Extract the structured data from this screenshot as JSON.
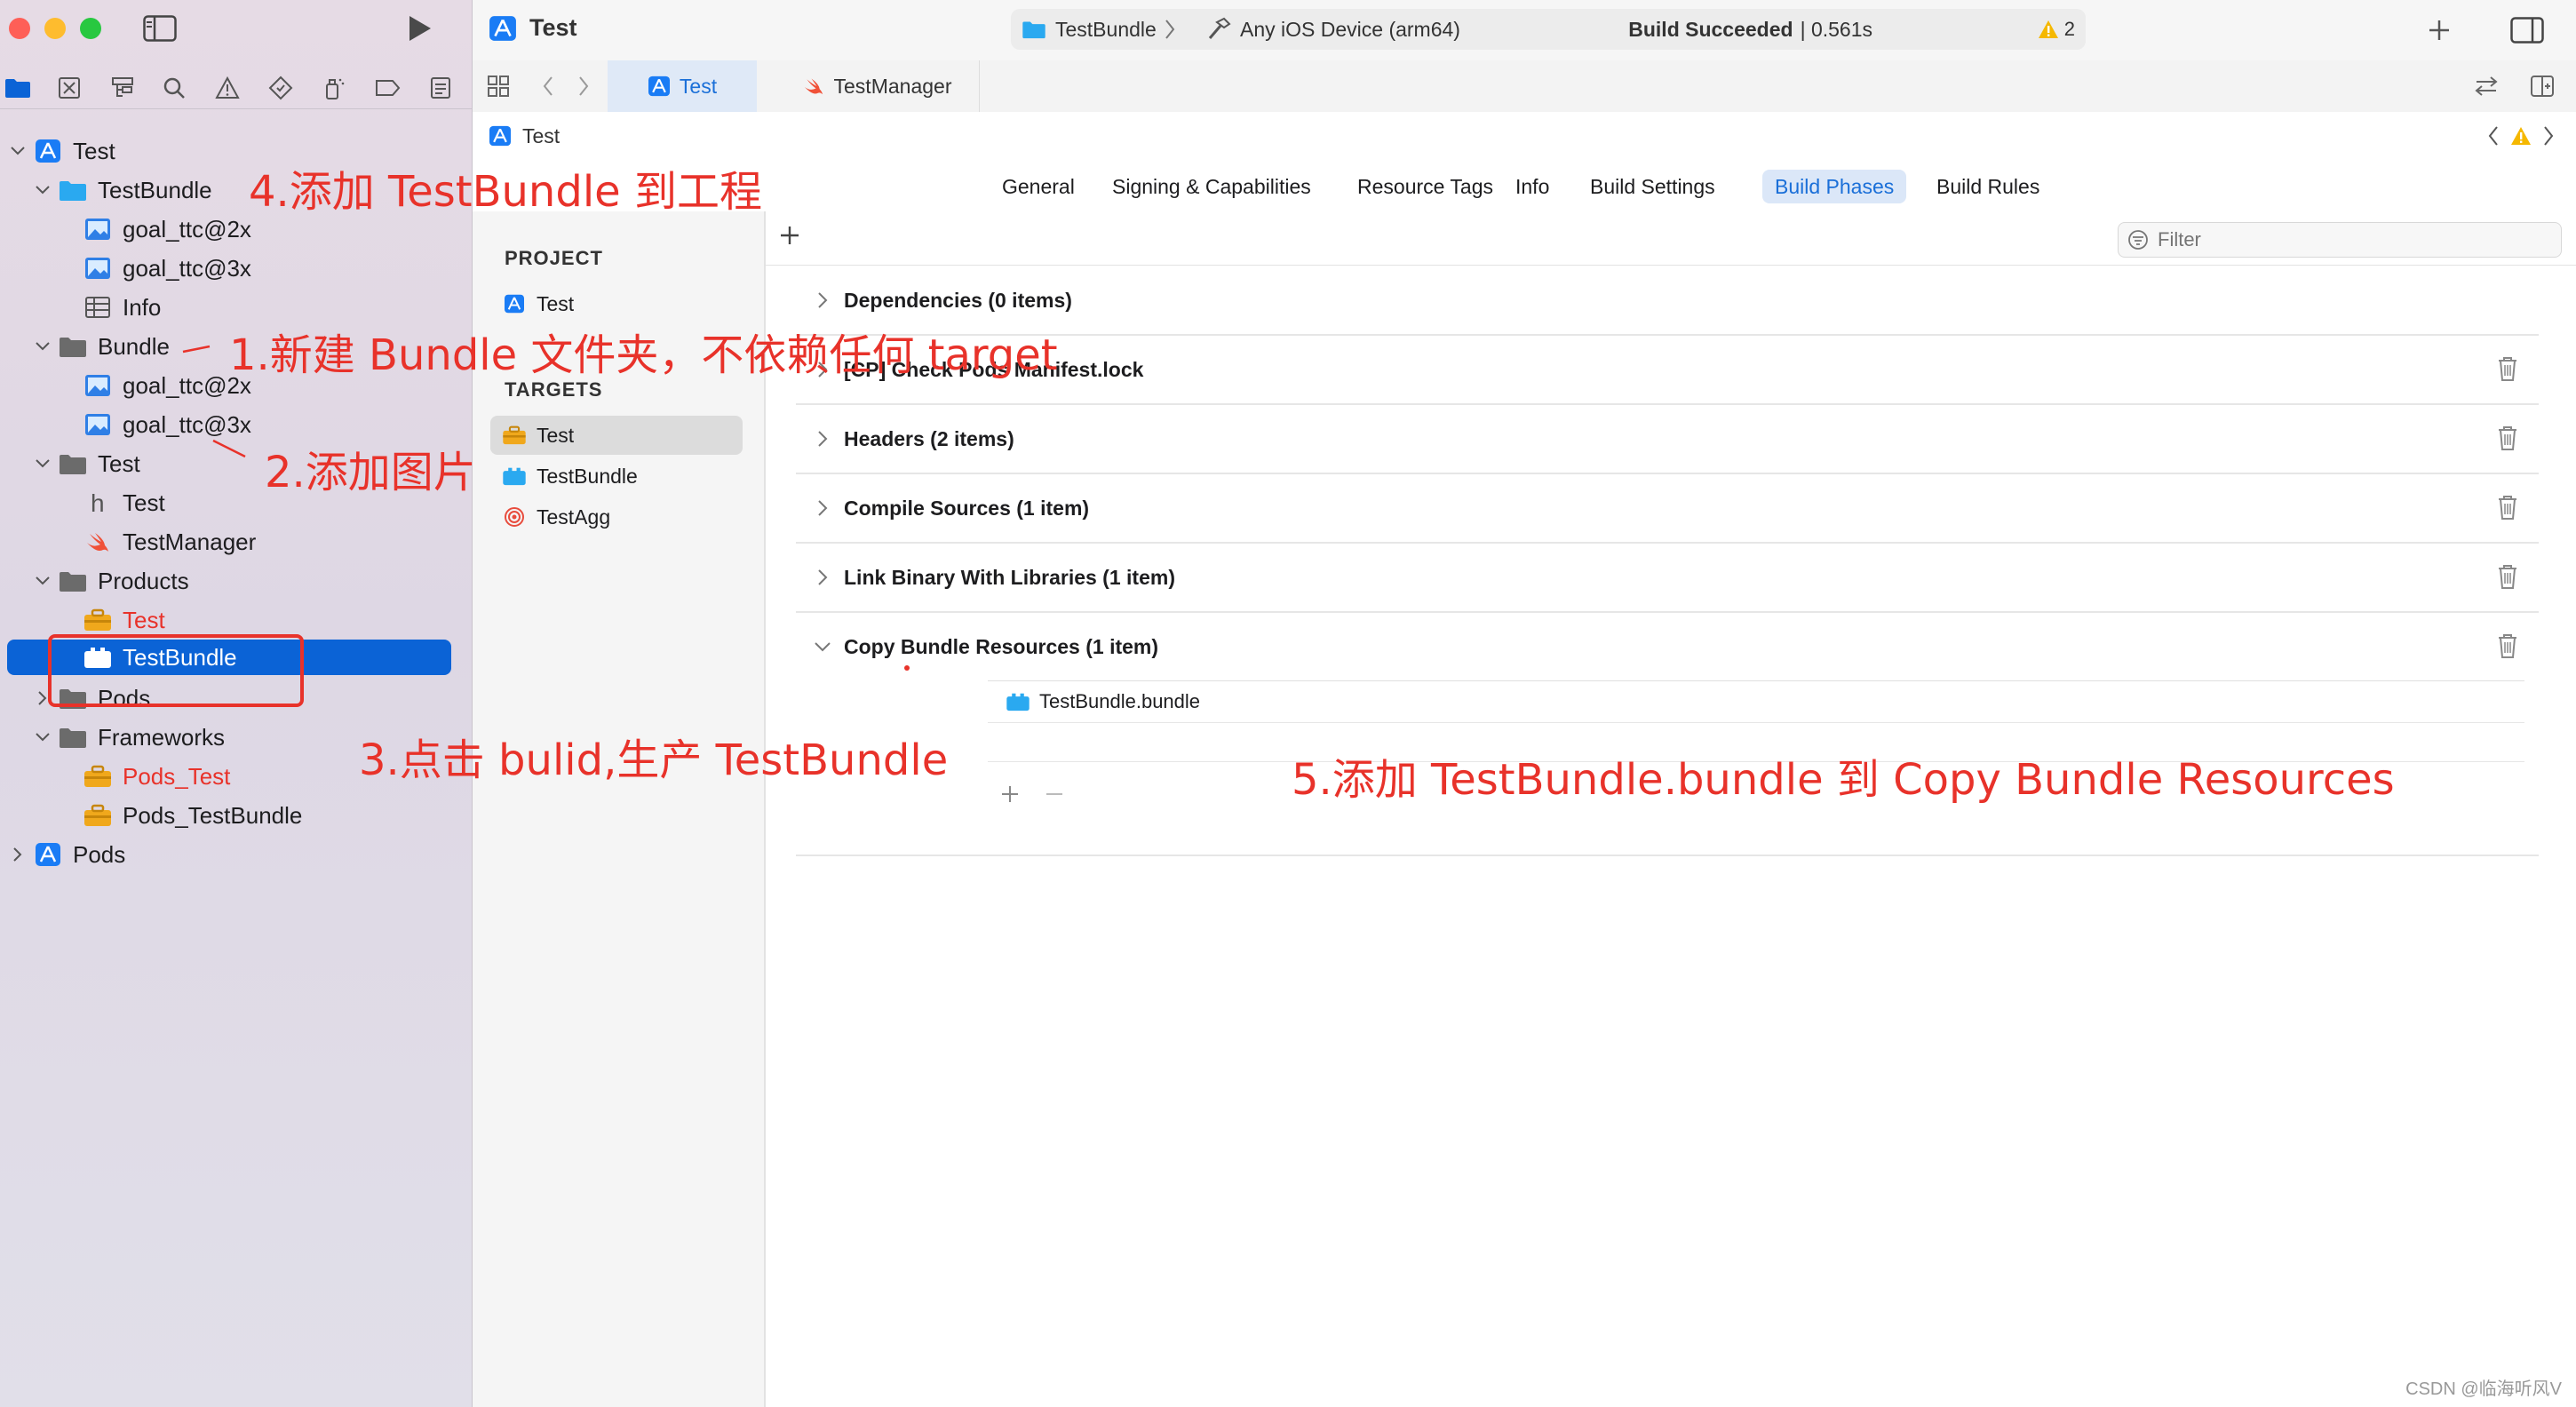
{
  "window": {
    "project_name": "Test",
    "scheme": "TestBundle",
    "device": "Any iOS Device (arm64)",
    "build_status_bold": "Build Succeeded",
    "build_time": "| 0.561s",
    "warning_count": "2"
  },
  "editor_tabs": [
    {
      "label": "Test"
    },
    {
      "label": "TestManager"
    }
  ],
  "jumpbar": {
    "label": "Test"
  },
  "navigator": {
    "tree": [
      {
        "label": "Test"
      },
      {
        "label": "TestBundle"
      },
      {
        "label": "goal_ttc@2x"
      },
      {
        "label": "goal_ttc@3x"
      },
      {
        "label": "Info"
      },
      {
        "label": "Bundle"
      },
      {
        "label": "goal_ttc@2x"
      },
      {
        "label": "goal_ttc@3x"
      },
      {
        "label": "Test"
      },
      {
        "label": "Test"
      },
      {
        "label": "TestManager"
      },
      {
        "label": "Products"
      },
      {
        "label": "Test"
      },
      {
        "label": "TestBundle"
      },
      {
        "label": "Pods"
      },
      {
        "label": "Frameworks"
      },
      {
        "label": "Pods_Test"
      },
      {
        "label": "Pods_TestBundle"
      },
      {
        "label": "Pods"
      }
    ]
  },
  "settings_tabs": [
    {
      "label": "General"
    },
    {
      "label": "Signing & Capabilities"
    },
    {
      "label": "Resource Tags"
    },
    {
      "label": "Info"
    },
    {
      "label": "Build Settings"
    },
    {
      "label": "Build Phases"
    },
    {
      "label": "Build Rules"
    }
  ],
  "targets_pane": {
    "project_header": "PROJECT",
    "project_item": "Test",
    "targets_header": "TARGETS",
    "targets": [
      {
        "label": "Test"
      },
      {
        "label": "TestBundle"
      },
      {
        "label": "TestAgg"
      }
    ]
  },
  "build_phases": {
    "filter_placeholder": "Filter",
    "phases": [
      {
        "label": "Dependencies (0 items)"
      },
      {
        "label": "[CP] Check Pods Manifest.lock"
      },
      {
        "label": "Headers (2 items)"
      },
      {
        "label": "Compile Sources (1 item)"
      },
      {
        "label": "Link Binary With Libraries (1 item)"
      },
      {
        "label": "Copy Bundle Resources (1 item)"
      }
    ],
    "copy_bundle_item": "TestBundle.bundle"
  },
  "annotations": {
    "step1": "1.新建 Bundle 文件夹，不依赖任何 target",
    "step2": "2.添加图片",
    "step3": "3.点击 bulid,生产 TestBundle",
    "step4": "4.添加 TestBundle 到工程",
    "step5": "5.添加 TestBundle.bundle 到 Copy Bundle Resources"
  },
  "watermark": "CSDN @临海听风V",
  "colors": {
    "accent": "#0b63d6",
    "annotation_red": "#e8322a",
    "folder_blue": "#2aa9f0",
    "warning_yellow": "#f5b800"
  },
  "icons": {
    "close": "close-traffic-light",
    "minimize": "minimize-traffic-light",
    "zoom": "zoom-traffic-light",
    "run": "play-icon",
    "sidebar_toggle": "sidebar-icon",
    "library": "plus-icon",
    "inspector": "inspector-icon"
  }
}
